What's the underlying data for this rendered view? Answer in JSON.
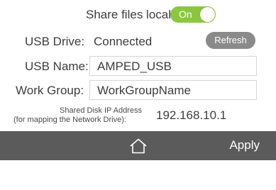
{
  "share": {
    "label": "Share files locally:",
    "toggle_text": "On"
  },
  "usb_drive": {
    "label": "USB Drive:",
    "status": "Connected",
    "refresh_label": "Refresh"
  },
  "usb_name": {
    "label": "USB Name:",
    "value": "AMPED_USB"
  },
  "work_group": {
    "label": "Work Group:",
    "value": "WorkGroupName"
  },
  "ip": {
    "label_line1": "Shared Disk IP Address",
    "label_line2": "(for mapping the Network Drive):",
    "value": "192.168.10.1"
  },
  "bottom_bar": {
    "apply_label": "Apply",
    "home_icon": "home-icon"
  },
  "colors": {
    "toggle_on": "#8cc63f",
    "refresh_bg": "#8a8a8a",
    "bar_bg": "#5b5b5b"
  }
}
